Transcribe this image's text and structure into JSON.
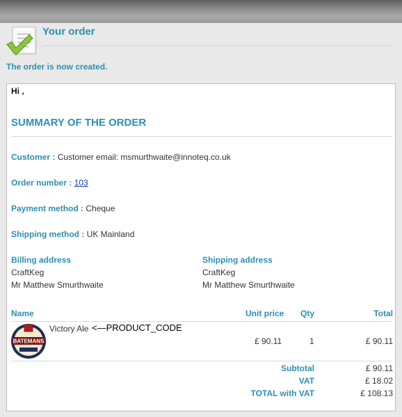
{
  "header": {
    "title": "Your order",
    "notice": "The order is now created."
  },
  "order": {
    "greeting": "Hi ,",
    "summary_title": "SUMMARY OF THE ORDER",
    "customer": {
      "label": "Customer :",
      "value": "Customer email: msmurthwaite@innoteq.co.uk"
    },
    "order_number": {
      "label": "Order number :",
      "value": "103"
    },
    "payment": {
      "label": "Payment method :",
      "value": "Cheque"
    },
    "shipping": {
      "label": "Shipping method :",
      "value": "UK Mainland"
    },
    "billing_address": {
      "heading": "Billing address",
      "lines": [
        "CraftKeg",
        "Mr Matthew Smurthwaite"
      ]
    },
    "shipping_address": {
      "heading": "Shipping address",
      "lines": [
        "CraftKeg",
        "Mr Matthew Smurthwaite"
      ]
    },
    "table": {
      "headers": {
        "name": "Name",
        "unit_price": "Unit price",
        "qty": "Qty",
        "total": "Total"
      },
      "items": [
        {
          "name": "Victory Ale",
          "code": "<—PRODUCT_CODE",
          "unit_price": "£ 90.11",
          "qty": "1",
          "total": "£ 90.11",
          "image_text": "BATEMANS"
        }
      ],
      "totals": [
        {
          "label": "Subtotal",
          "value": "£ 90.11"
        },
        {
          "label": "VAT",
          "value": "£ 18.02"
        },
        {
          "label": "TOTAL with VAT",
          "value": "£ 108.13"
        }
      ]
    }
  },
  "colors": {
    "accent": "#2d8fb0",
    "link": "#1a3cc9"
  },
  "icons": {
    "header": "checked-document-icon"
  }
}
